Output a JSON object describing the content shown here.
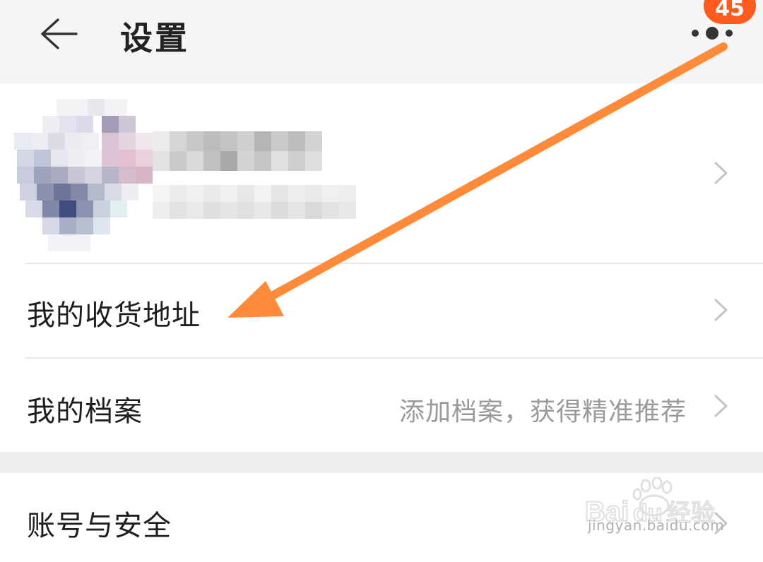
{
  "header": {
    "title": "设置",
    "back_icon": "arrow-left-icon",
    "more_icon": "more-dots-icon",
    "badge_count": "45"
  },
  "profile": {
    "avatar_icon": "pixelated-avatar",
    "name": "",
    "subtitle": ""
  },
  "rows": [
    {
      "label": "我的收货地址",
      "hint": ""
    },
    {
      "label": "我的档案",
      "hint": "添加档案，获得精准推荐"
    },
    {
      "label": "账号与安全",
      "hint": ""
    }
  ],
  "annotation": {
    "type": "orange-arrow",
    "color": "#ff8a3a"
  },
  "watermark": {
    "brand": "Baidu经验",
    "domain": "jingyan.baidu.com"
  },
  "colors": {
    "accent": "#ff5a1f",
    "arrow": "#ff8a3a",
    "header_bg": "#f5f5f5",
    "gap_bg": "#efefef"
  }
}
